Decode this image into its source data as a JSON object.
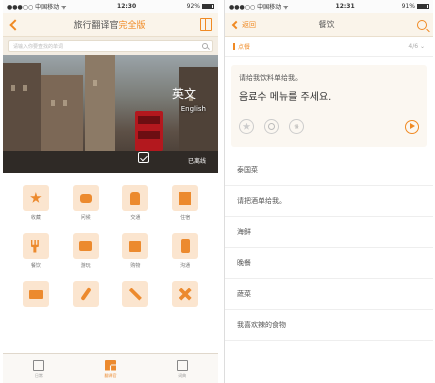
{
  "left": {
    "status": {
      "carrier": "●●●○○ 中国移动 ᯤ",
      "time": "12:30",
      "battery": "92%",
      "battery_level": 0.92
    },
    "nav": {
      "title_main": "旅行翻译官",
      "title_accent": "完全版"
    },
    "search": {
      "placeholder": "请输入你要查找的单词"
    },
    "banner": {
      "language": "英文",
      "language_en": "English",
      "downloaded": "已离线"
    },
    "grid": [
      {
        "label": "收藏",
        "icon": "star-icon"
      },
      {
        "label": "问候",
        "icon": "chat-bubble-icon"
      },
      {
        "label": "交通",
        "icon": "bus-icon"
      },
      {
        "label": "住宿",
        "icon": "hotel-icon"
      },
      {
        "label": "餐饮",
        "icon": "fork-knife-icon"
      },
      {
        "label": "游玩",
        "icon": "camera-icon"
      },
      {
        "label": "购物",
        "icon": "shopping-bag-icon"
      },
      {
        "label": "沟通",
        "icon": "phone-icon"
      },
      {
        "label": "",
        "icon": "card-icon"
      },
      {
        "label": "",
        "icon": "wrench-icon"
      },
      {
        "label": "",
        "icon": "tools-icon"
      },
      {
        "label": "",
        "icon": "medical-cross-icon"
      }
    ],
    "tabs": [
      {
        "label": "日常",
        "icon": "checklist-icon",
        "active": false
      },
      {
        "label": "翻译官",
        "icon": "grid-icon",
        "active": true
      },
      {
        "label": "词典",
        "icon": "dictionary-icon",
        "active": false
      }
    ]
  },
  "right": {
    "status": {
      "carrier": "●●●○○ 中国移动 ᯤ",
      "time": "12:31",
      "battery": "91%",
      "battery_level": 0.91
    },
    "nav": {
      "back_label": "返回",
      "title": "餐饮"
    },
    "subheader": {
      "left": "点餐",
      "right": "4/6 ⌄"
    },
    "card": {
      "chinese": "请给我饮料单给我。",
      "korean": "음료수 메뉴를 주세요.",
      "action_labels": [
        "",
        "",
        "慢"
      ]
    },
    "list": [
      "泰国菜",
      "请把酒单给我。",
      "海鲜",
      "晚餐",
      "蔬菜",
      "我喜欢辣的食物"
    ]
  }
}
